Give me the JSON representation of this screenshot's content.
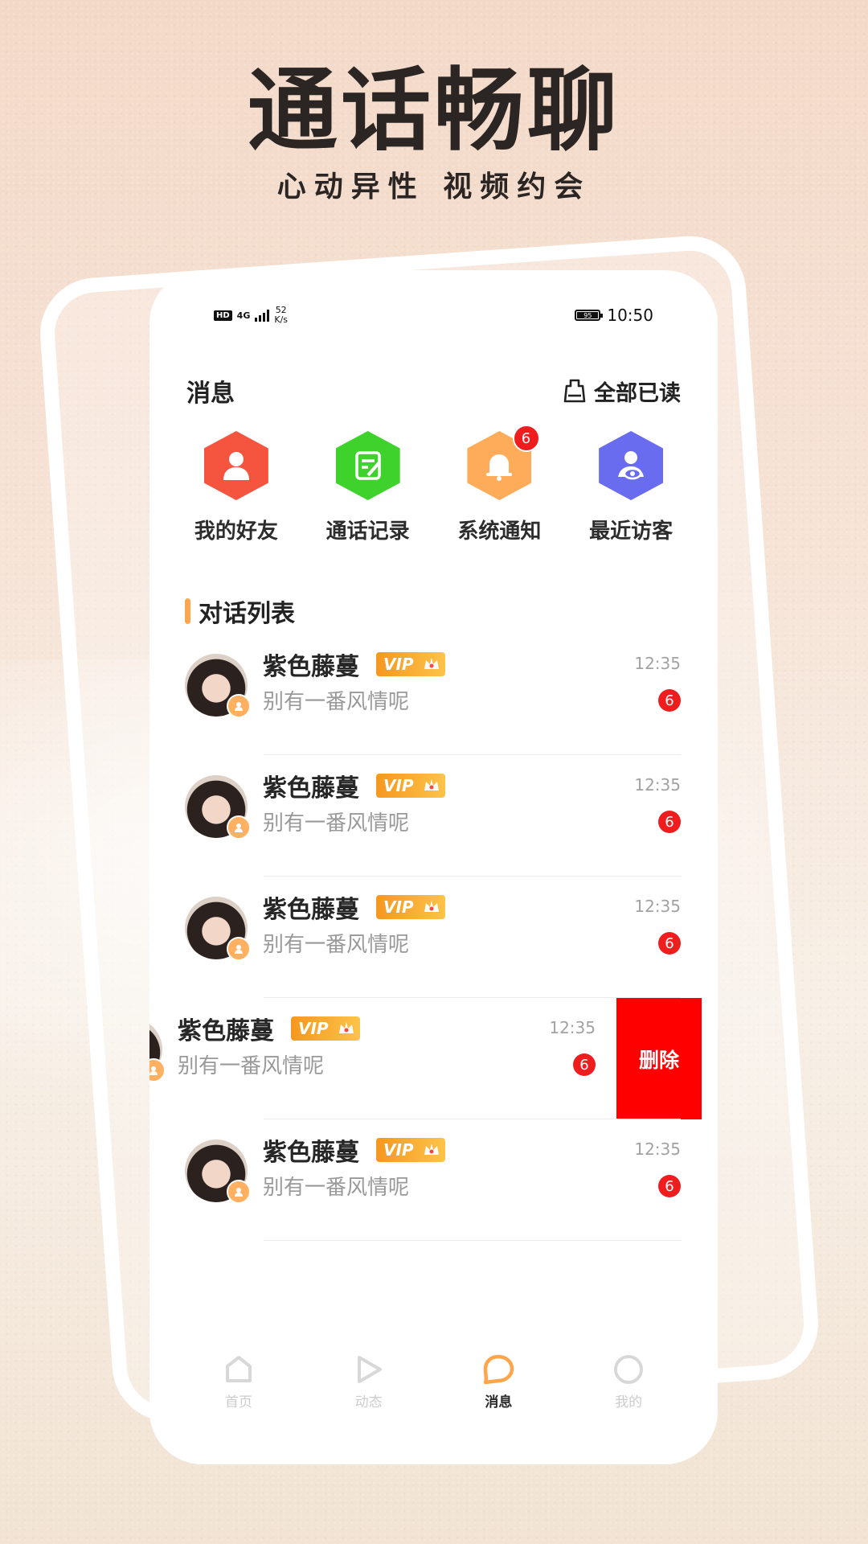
{
  "promo": {
    "headline": "通话畅聊",
    "subline": "心动异性  视频约会"
  },
  "status_bar": {
    "hd": "HD",
    "network": "4G",
    "speed_value": "52",
    "speed_unit": "K/s",
    "battery": "95",
    "time": "10:50"
  },
  "header": {
    "title": "消息",
    "read_all_label": "全部已读"
  },
  "shortcuts": [
    {
      "label": "我的好友",
      "icon": "friend-icon",
      "color": "#f5553f"
    },
    {
      "label": "通话记录",
      "icon": "call-record-icon",
      "color": "#3fd22d"
    },
    {
      "label": "系统通知",
      "icon": "bell-icon",
      "color": "#ffac5a",
      "badge": "6"
    },
    {
      "label": "最近访客",
      "icon": "visitor-icon",
      "color": "#6a6cf0"
    }
  ],
  "section": {
    "title": "对话列表"
  },
  "conversations": [
    {
      "name": "紫色藤蔓",
      "vip": "VIP",
      "message": "别有一番风情呢",
      "time": "12:35",
      "unread": "6"
    },
    {
      "name": "紫色藤蔓",
      "vip": "VIP",
      "message": "别有一番风情呢",
      "time": "12:35",
      "unread": "6"
    },
    {
      "name": "紫色藤蔓",
      "vip": "VIP",
      "message": "别有一番风情呢",
      "time": "12:35",
      "unread": "6"
    },
    {
      "name": "紫色藤蔓",
      "vip": "VIP",
      "message": "别有一番风情呢",
      "time": "12:35",
      "unread": "6",
      "swiped": true,
      "delete_label": "删除"
    },
    {
      "name": "紫色藤蔓",
      "vip": "VIP",
      "message": "别有一番风情呢",
      "time": "12:35",
      "unread": "6"
    }
  ],
  "bottom_nav": [
    {
      "label": "首页",
      "icon": "home-icon"
    },
    {
      "label": "动态",
      "icon": "play-icon"
    },
    {
      "label": "消息",
      "icon": "chat-bubble-icon",
      "active": true
    },
    {
      "label": "我的",
      "icon": "profile-circle-icon"
    }
  ],
  "colors": {
    "accent": "#ffa64d",
    "badge_red": "#ef1d1d",
    "delete_red": "#fe0000"
  }
}
